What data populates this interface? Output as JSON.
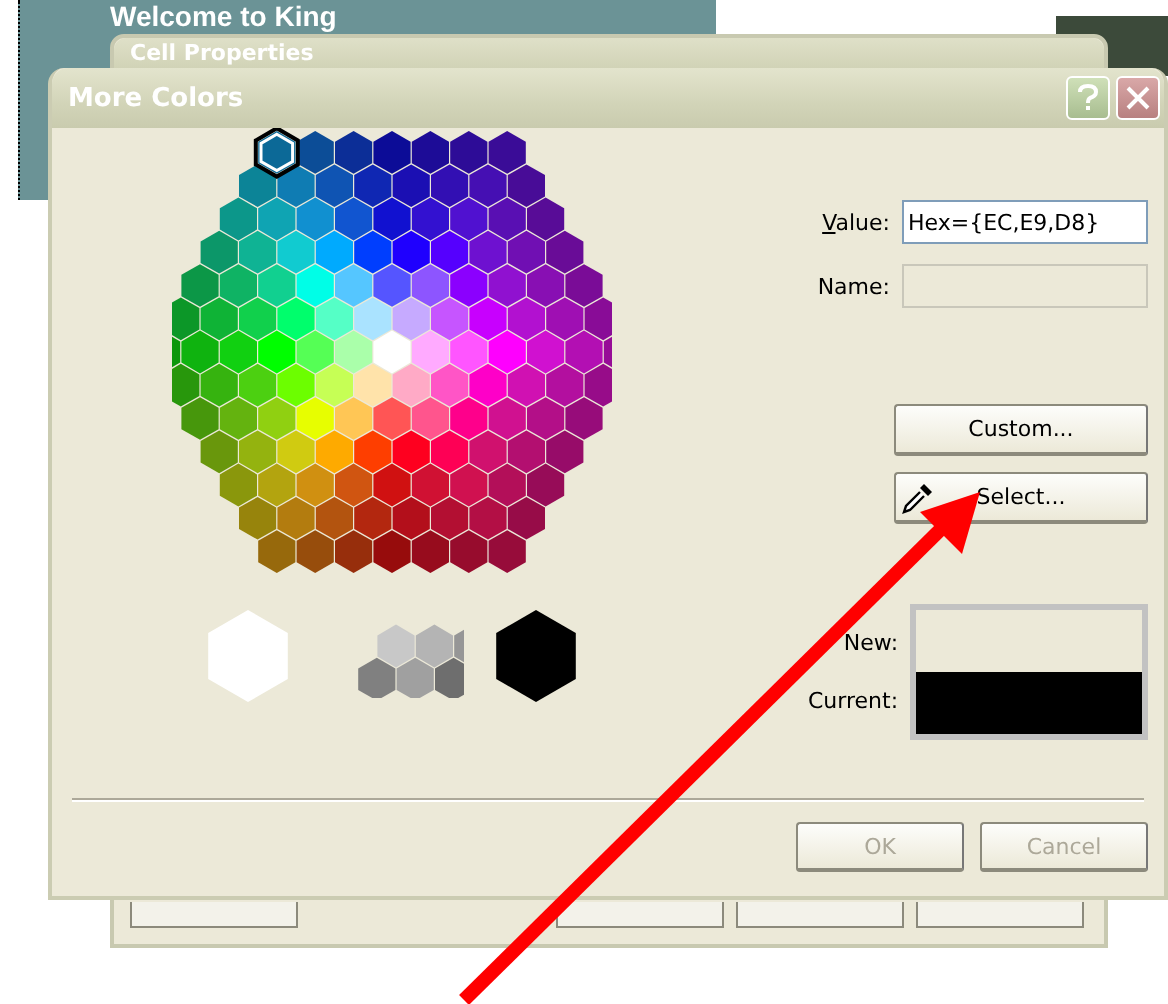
{
  "background_page": {
    "banner_title": "Welcome to King"
  },
  "back_window": {
    "title": "Cell Properties"
  },
  "dialog": {
    "title": "More Colors"
  },
  "palette": {
    "first_cell_selected": true
  },
  "fields": [
    {
      "label": "Value:",
      "value": "Hex={EC,E9,D8}",
      "disabled": false
    },
    {
      "label": "Name:",
      "disabled": true
    }
  ],
  "action_buttons": [
    {
      "label": "Custom...",
      "kind": "plain"
    },
    {
      "label": "Select...",
      "kind": "picker"
    }
  ],
  "preview": {
    "new_label": "New:",
    "current_label": "Current:"
  },
  "buttons": [
    {
      "label": "OK",
      "disabled": true
    },
    {
      "label": "Cancel",
      "disabled": true
    }
  ]
}
